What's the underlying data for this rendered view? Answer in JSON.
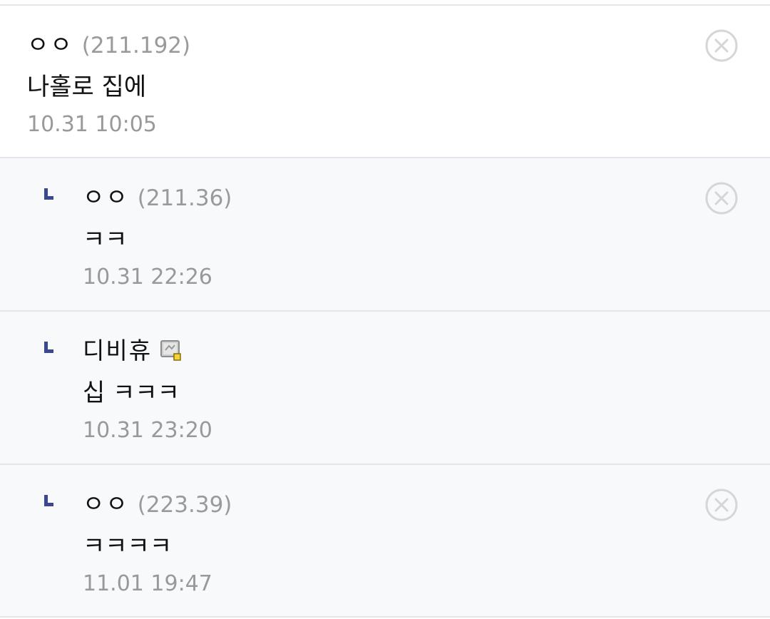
{
  "comments": [
    {
      "nickname": "ㅇㅇ",
      "ip": "(211.192)",
      "text": "나홀로 집에",
      "date": "10.31 10:05",
      "delete_icon": "close-circle-icon"
    },
    {
      "nickname": "ㅇㅇ",
      "ip": "(211.36)",
      "text": "ㅋㅋ",
      "date": "10.31 22:26",
      "reply_icon": "reply-arrow-icon",
      "delete_icon": "close-circle-icon"
    },
    {
      "nickname": "디비휴",
      "badge_icon": "gallog-fixed-nick-icon",
      "text": "십 ㅋㅋㅋ",
      "date": "10.31 23:20",
      "reply_icon": "reply-arrow-icon"
    },
    {
      "nickname": "ㅇㅇ",
      "ip": "(223.39)",
      "text": "ㅋㅋㅋㅋ",
      "date": "11.01 19:47",
      "reply_icon": "reply-arrow-icon",
      "delete_icon": "close-circle-icon"
    }
  ],
  "colors": {
    "reply_mark": "#3b4890",
    "reply_background": "#f8f9fb",
    "divider": "#e4e5ea",
    "meta_text": "#999999",
    "delete_icon": "#d6d6d6"
  }
}
